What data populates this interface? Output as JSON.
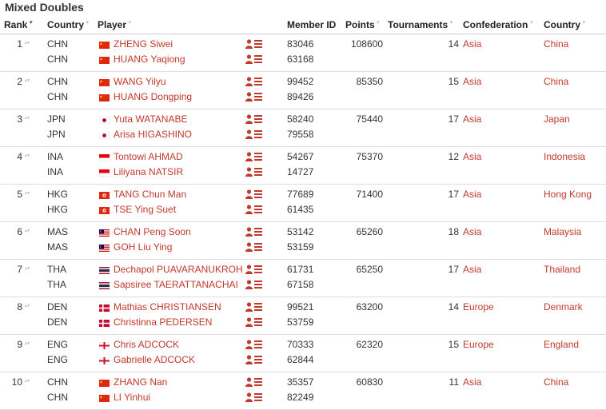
{
  "page": {
    "title": "Mixed Doubles"
  },
  "columns": [
    "Rank",
    "Country",
    "Player",
    "Member ID",
    "Points",
    "Tournaments",
    "Confederation",
    "Country"
  ],
  "rows": [
    {
      "rank": "1",
      "points": "108600",
      "tournaments": "14",
      "confederation": "Asia",
      "country_name": "China",
      "players": [
        {
          "code": "CHN",
          "flag": "chn",
          "name": "ZHENG Siwei",
          "member_id": "83046"
        },
        {
          "code": "CHN",
          "flag": "chn",
          "name": "HUANG Yaqiong",
          "member_id": "63168"
        }
      ]
    },
    {
      "rank": "2",
      "points": "85350",
      "tournaments": "15",
      "confederation": "Asia",
      "country_name": "China",
      "players": [
        {
          "code": "CHN",
          "flag": "chn",
          "name": "WANG Yilyu",
          "member_id": "99452"
        },
        {
          "code": "CHN",
          "flag": "chn",
          "name": "HUANG Dongping",
          "member_id": "89426"
        }
      ]
    },
    {
      "rank": "3",
      "points": "75440",
      "tournaments": "17",
      "confederation": "Asia",
      "country_name": "Japan",
      "players": [
        {
          "code": "JPN",
          "flag": "jpn",
          "name": "Yuta WATANABE",
          "member_id": "58240"
        },
        {
          "code": "JPN",
          "flag": "jpn",
          "name": "Arisa HIGASHINO",
          "member_id": "79558"
        }
      ]
    },
    {
      "rank": "4",
      "points": "75370",
      "tournaments": "12",
      "confederation": "Asia",
      "country_name": "Indonesia",
      "players": [
        {
          "code": "INA",
          "flag": "ina",
          "name": "Tontowi AHMAD",
          "member_id": "54267"
        },
        {
          "code": "INA",
          "flag": "ina",
          "name": "Liliyana NATSIR",
          "member_id": "14727"
        }
      ]
    },
    {
      "rank": "5",
      "points": "71400",
      "tournaments": "17",
      "confederation": "Asia",
      "country_name": "Hong Kong",
      "players": [
        {
          "code": "HKG",
          "flag": "hkg",
          "name": "TANG Chun Man",
          "member_id": "77689"
        },
        {
          "code": "HKG",
          "flag": "hkg",
          "name": "TSE Ying Suet",
          "member_id": "61435"
        }
      ]
    },
    {
      "rank": "6",
      "points": "65260",
      "tournaments": "18",
      "confederation": "Asia",
      "country_name": "Malaysia",
      "players": [
        {
          "code": "MAS",
          "flag": "mas",
          "name": "CHAN Peng Soon",
          "member_id": "53142"
        },
        {
          "code": "MAS",
          "flag": "mas",
          "name": "GOH Liu Ying",
          "member_id": "53159"
        }
      ]
    },
    {
      "rank": "7",
      "points": "65250",
      "tournaments": "17",
      "confederation": "Asia",
      "country_name": "Thailand",
      "players": [
        {
          "code": "THA",
          "flag": "tha",
          "name": "Dechapol PUAVARANUKROH",
          "member_id": "61731"
        },
        {
          "code": "THA",
          "flag": "tha",
          "name": "Sapsiree TAERATTANACHAI",
          "member_id": "67158"
        }
      ]
    },
    {
      "rank": "8",
      "points": "63200",
      "tournaments": "14",
      "confederation": "Europe",
      "country_name": "Denmark",
      "players": [
        {
          "code": "DEN",
          "flag": "den",
          "name": "Mathias CHRISTIANSEN",
          "member_id": "99521"
        },
        {
          "code": "DEN",
          "flag": "den",
          "name": "Christinna PEDERSEN",
          "member_id": "53759"
        }
      ]
    },
    {
      "rank": "9",
      "points": "62320",
      "tournaments": "15",
      "confederation": "Europe",
      "country_name": "England",
      "players": [
        {
          "code": "ENG",
          "flag": "eng",
          "name": "Chris ADCOCK",
          "member_id": "70333"
        },
        {
          "code": "ENG",
          "flag": "eng",
          "name": "Gabrielle ADCOCK",
          "member_id": "62844"
        }
      ]
    },
    {
      "rank": "10",
      "points": "60830",
      "tournaments": "11",
      "confederation": "Asia",
      "country_name": "China",
      "players": [
        {
          "code": "CHN",
          "flag": "chn",
          "name": "ZHANG Nan",
          "member_id": "35357"
        },
        {
          "code": "CHN",
          "flag": "chn",
          "name": "LI Yinhui",
          "member_id": "82249"
        }
      ]
    }
  ],
  "colors": {
    "link": "#c0392b",
    "text": "#333333",
    "border": "#dddddd"
  },
  "icons": {
    "profile": "user-list-icon",
    "sort": "sort-icon"
  }
}
